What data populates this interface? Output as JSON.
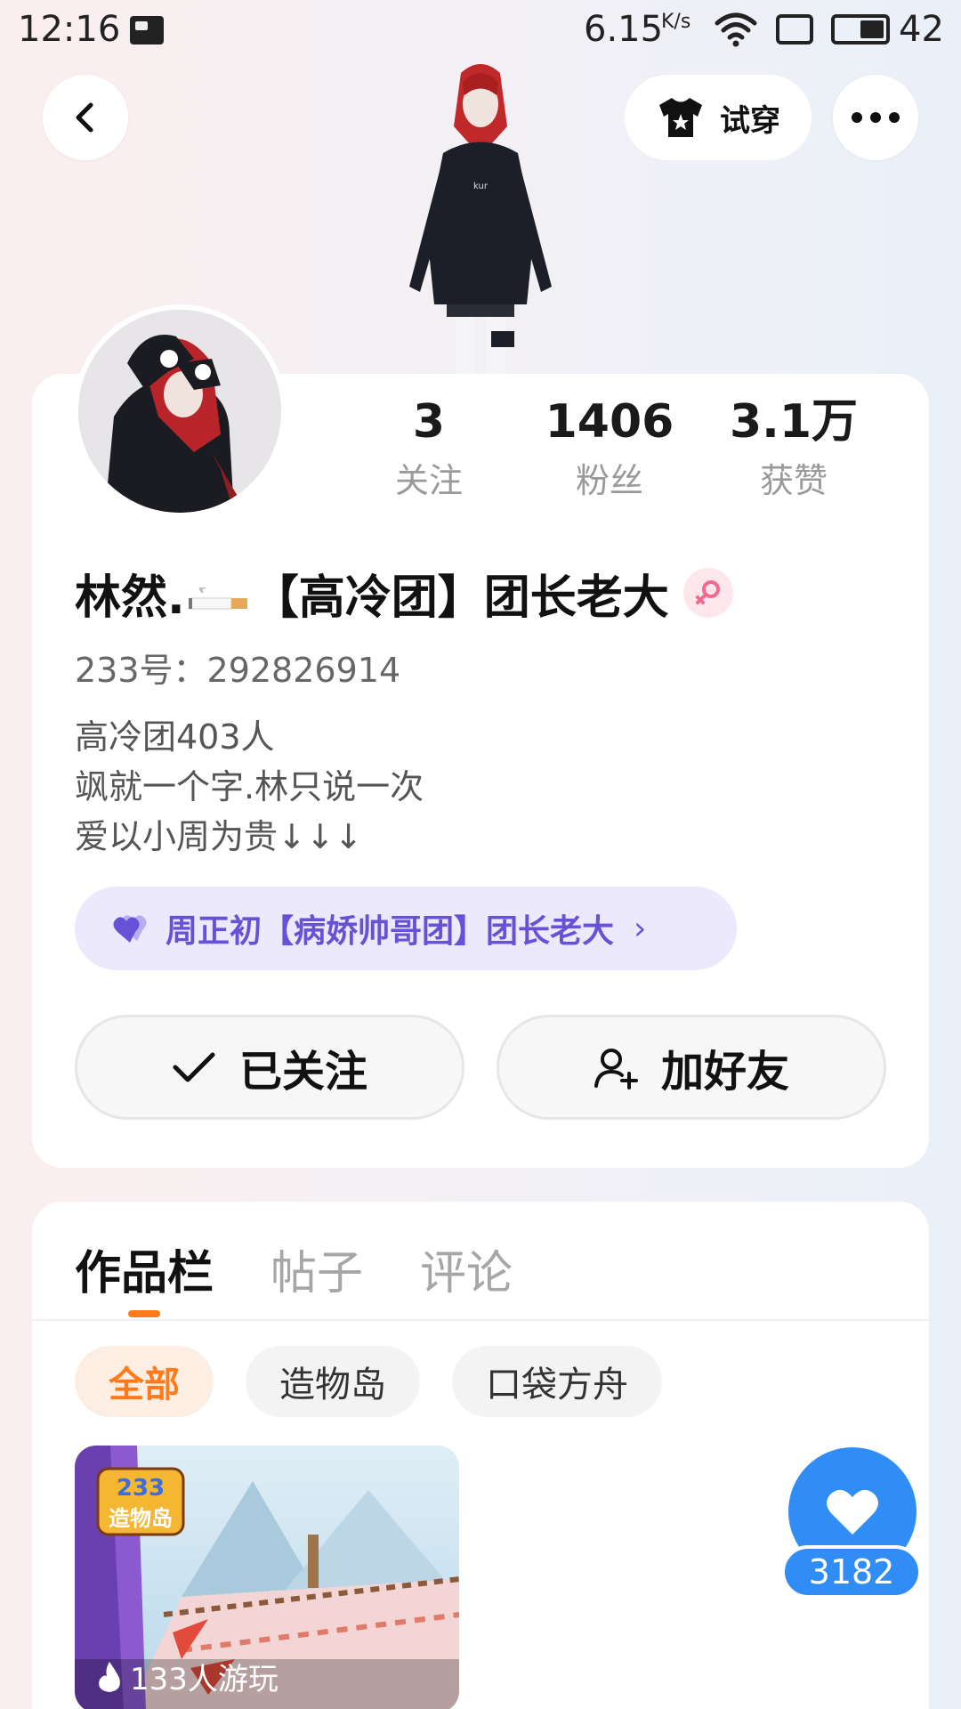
{
  "status_bar": {
    "time": "12:16",
    "speed": "6.15",
    "speed_unit": "K/s",
    "battery": "42"
  },
  "top_nav": {
    "tryon_label": "试穿"
  },
  "profile": {
    "stats": [
      {
        "value": "3",
        "label": "关注"
      },
      {
        "value": "1406",
        "label": "粉丝"
      },
      {
        "value": "3.1万",
        "label": "获赞"
      }
    ],
    "nickname_start": "林然.",
    "nickname_end": "【高冷团】团长老大",
    "uid": "233号：292826914",
    "bio": [
      "高冷团403人",
      "飒就一个字.林只说一次",
      "爱以小周为贵↓↓↓"
    ],
    "cp_tag": "周正初【病娇帅哥团】团长老大",
    "followed_label": "已关注",
    "add_friend_label": "加好友"
  },
  "content": {
    "tabs": [
      "作品栏",
      "帖子",
      "评论"
    ],
    "active_tab": 0,
    "filters": [
      "全部",
      "造物岛",
      "口袋方舟"
    ],
    "active_filter": 0,
    "work": {
      "logo_line1": "233",
      "logo_line2": "造物岛",
      "plays": "133人游玩"
    },
    "like_count": "3182"
  },
  "colors": {
    "accent_orange": "#ff7a1a",
    "cp_purple": "#6652d6",
    "like_blue": "#2f8df5"
  }
}
